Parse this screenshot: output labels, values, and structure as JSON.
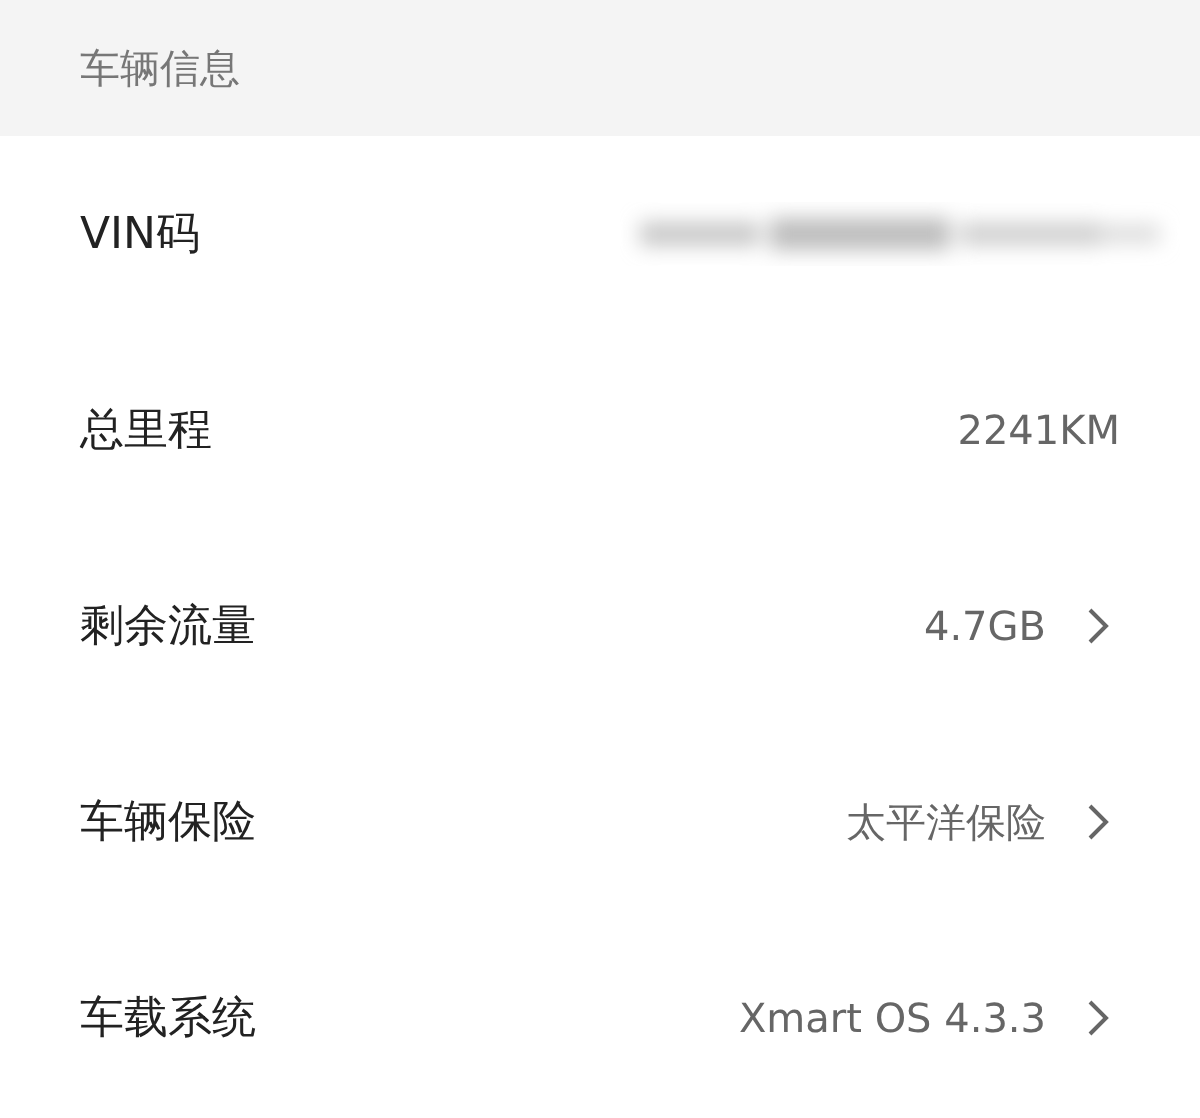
{
  "section_title": "车辆信息",
  "rows": [
    {
      "label": "VIN码",
      "kind": "redacted",
      "chevron": false
    },
    {
      "label": "总里程",
      "kind": "text",
      "value": "2241KM",
      "chevron": false
    },
    {
      "label": "剩余流量",
      "kind": "text",
      "value": "4.7GB",
      "chevron": true
    },
    {
      "label": "车辆保险",
      "kind": "text",
      "value": "太平洋保险",
      "chevron": true
    },
    {
      "label": "车载系统",
      "kind": "text",
      "value": "Xmart OS 4.3.3",
      "chevron": true
    }
  ]
}
